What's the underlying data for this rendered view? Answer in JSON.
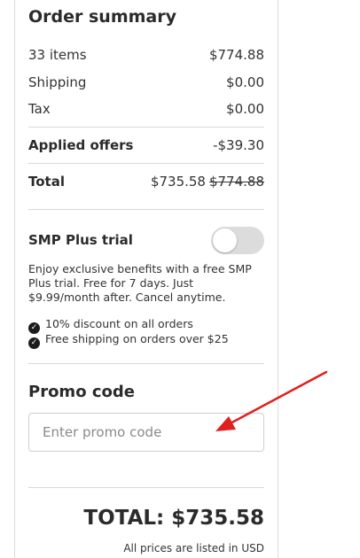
{
  "summary": {
    "title": "Order summary",
    "items_label": "33 items",
    "items_value": "$774.88",
    "shipping_label": "Shipping",
    "shipping_value": "$0.00",
    "tax_label": "Tax",
    "tax_value": "$0.00",
    "offers_label": "Applied offers",
    "offers_value": "-$39.30",
    "total_label": "Total",
    "total_value": "$735.58",
    "total_original": "$774.88"
  },
  "trial": {
    "title": "SMP Plus trial",
    "toggle_on": false,
    "description": "Enjoy exclusive benefits with a free SMP Plus trial. Free for 7 days. Just $9.99/month after. Cancel anytime.",
    "benefits": [
      "10% discount on all orders",
      "Free shipping on orders over $25"
    ]
  },
  "promo": {
    "title": "Promo code",
    "placeholder": "Enter promo code",
    "value": ""
  },
  "footer": {
    "grand_total": "TOTAL: $735.58",
    "note": "All prices are listed in USD"
  },
  "colors": {
    "annotation_arrow": "#e0201e",
    "toggle_off": "#dcdcdc"
  }
}
